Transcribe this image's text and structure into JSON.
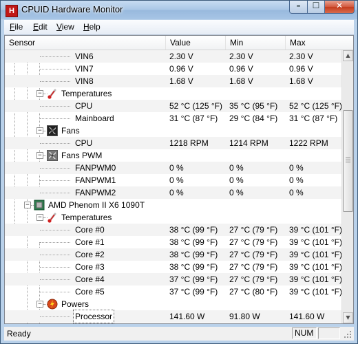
{
  "window": {
    "title": "CPUID Hardware Monitor",
    "app_icon_letter": "H"
  },
  "caption_buttons": {
    "minimize": "–",
    "maximize": "☐",
    "close": "✕"
  },
  "menu": [
    {
      "accel": "F",
      "rest": "ile"
    },
    {
      "accel": "E",
      "rest": "dit"
    },
    {
      "accel": "V",
      "rest": "iew"
    },
    {
      "accel": "H",
      "rest": "elp"
    }
  ],
  "columns": {
    "sensor": "Sensor",
    "value": "Value",
    "min": "Min",
    "max": "Max"
  },
  "rows": [
    {
      "kind": "leaf",
      "name": "VIN6",
      "value": "2.30 V",
      "min": "2.30 V",
      "max": "2.30 V",
      "shaded": true
    },
    {
      "kind": "leaf",
      "name": "VIN7",
      "value": "0.96 V",
      "min": "0.96 V",
      "max": "0.96 V",
      "shaded": false
    },
    {
      "kind": "leaf",
      "name": "VIN8",
      "value": "1.68 V",
      "min": "1.68 V",
      "max": "1.68 V",
      "shaded": true
    },
    {
      "kind": "group",
      "name": "Temperatures",
      "icon": "thermometer-icon"
    },
    {
      "kind": "leaf",
      "name": "CPU",
      "value": "52 °C  (125 °F)",
      "min": "35 °C  (95 °F)",
      "max": "52 °C  (125 °F)",
      "shaded": true
    },
    {
      "kind": "leaf",
      "name": "Mainboard",
      "value": "31 °C  (87 °F)",
      "min": "29 °C  (84 °F)",
      "max": "31 °C  (87 °F)",
      "shaded": false
    },
    {
      "kind": "group",
      "name": "Fans",
      "icon": "fan-icon"
    },
    {
      "kind": "leaf",
      "name": "CPU",
      "value": "1218 RPM",
      "min": "1214 RPM",
      "max": "1222 RPM",
      "shaded": true
    },
    {
      "kind": "group",
      "name": "Fans PWM",
      "icon": "fan-pwm-icon"
    },
    {
      "kind": "leaf",
      "name": "FANPWM0",
      "value": "0 %",
      "min": "0 %",
      "max": "0 %",
      "shaded": true
    },
    {
      "kind": "leaf",
      "name": "FANPWM1",
      "value": "0 %",
      "min": "0 %",
      "max": "0 %",
      "shaded": false
    },
    {
      "kind": "leaf",
      "name": "FANPWM2",
      "value": "0 %",
      "min": "0 %",
      "max": "0 %",
      "shaded": true
    },
    {
      "kind": "device",
      "name": "AMD Phenom II X6 1090T",
      "icon": "cpu-chip-icon"
    },
    {
      "kind": "group",
      "name": "Temperatures",
      "icon": "thermometer-icon"
    },
    {
      "kind": "leaf",
      "name": "Core #0",
      "value": "38 °C  (99 °F)",
      "min": "27 °C  (79 °F)",
      "max": "39 °C  (101 °F)",
      "shaded": true
    },
    {
      "kind": "leaf",
      "name": "Core #1",
      "value": "38 °C  (99 °F)",
      "min": "27 °C  (79 °F)",
      "max": "39 °C  (101 °F)",
      "shaded": false
    },
    {
      "kind": "leaf",
      "name": "Core #2",
      "value": "38 °C  (99 °F)",
      "min": "27 °C  (79 °F)",
      "max": "39 °C  (101 °F)",
      "shaded": true
    },
    {
      "kind": "leaf",
      "name": "Core #3",
      "value": "38 °C  (99 °F)",
      "min": "27 °C  (79 °F)",
      "max": "39 °C  (101 °F)",
      "shaded": false
    },
    {
      "kind": "leaf",
      "name": "Core #4",
      "value": "37 °C  (99 °F)",
      "min": "27 °C  (79 °F)",
      "max": "39 °C  (101 °F)",
      "shaded": true
    },
    {
      "kind": "leaf",
      "name": "Core #5",
      "value": "37 °C  (99 °F)",
      "min": "27 °C  (80 °F)",
      "max": "39 °C  (101 °F)",
      "shaded": false
    },
    {
      "kind": "group",
      "name": "Powers",
      "icon": "power-icon"
    },
    {
      "kind": "leaf",
      "name": "Processor",
      "value": "141.60 W",
      "min": "91.80 W",
      "max": "141.60 W",
      "shaded": true,
      "selected": true
    }
  ],
  "status": {
    "text": "Ready",
    "num": "NUM"
  }
}
